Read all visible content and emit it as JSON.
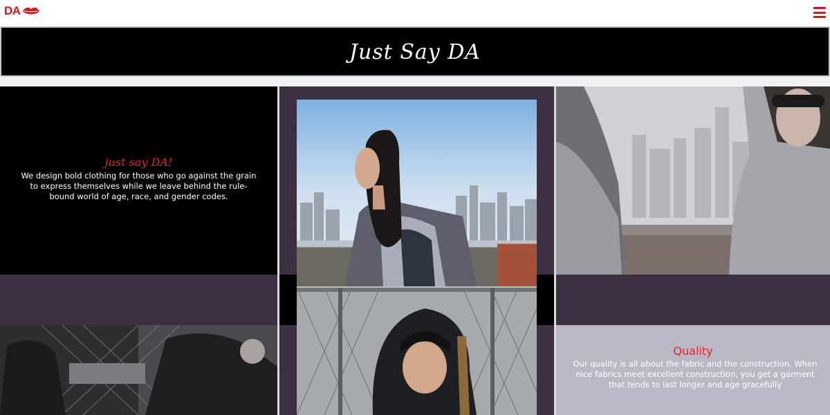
{
  "header": {
    "logo_text": "DA",
    "logo_icon": "lips-icon",
    "menu_icon": "hamburger-menu-icon",
    "accent_color": "#e0101a"
  },
  "banner": {
    "title": "Just Say DA"
  },
  "intro": {
    "heading": "just say DA!",
    "body": "We design bold clothing for those who go against the grain to express themselves while we leave behind the rule-bound world of age, race, and gender codes."
  },
  "quality": {
    "heading": "Quality",
    "body": "Our quality is all about the fabric and the construction. When nice fabrics meet excellent construction, you get a garment that tends to last longer and age gracefully"
  },
  "colors": {
    "purple": "#3c2f41",
    "black": "#000000",
    "grey_panel": "#b9b9c6",
    "heading_red": "#e5202a"
  }
}
